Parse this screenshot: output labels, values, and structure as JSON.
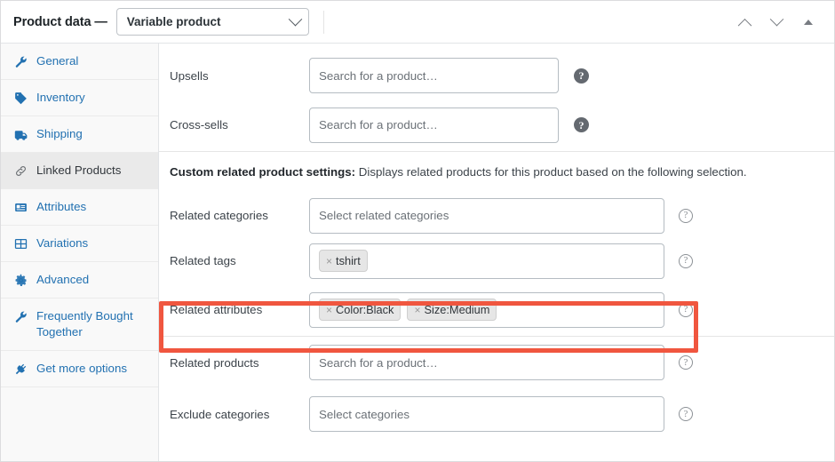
{
  "header": {
    "title": "Product data —",
    "product_type": "Variable product",
    "controls": {
      "move_up": "chevron-up",
      "move_down": "chevron-down",
      "toggle": "triangle-up"
    }
  },
  "sidebar": {
    "items": [
      {
        "label": "General",
        "icon": "wrench-icon",
        "active": false
      },
      {
        "label": "Inventory",
        "icon": "tag-icon",
        "active": false
      },
      {
        "label": "Shipping",
        "icon": "truck-icon",
        "active": false
      },
      {
        "label": "Linked Products",
        "icon": "link-icon",
        "active": true
      },
      {
        "label": "Attributes",
        "icon": "attributes-icon",
        "active": false
      },
      {
        "label": "Variations",
        "icon": "grid-icon",
        "active": false
      },
      {
        "label": "Advanced",
        "icon": "gear-icon",
        "active": false
      },
      {
        "label": "Frequently Bought Together",
        "icon": "wrench-icon",
        "active": false
      },
      {
        "label": "Get more options",
        "icon": "plugin-icon",
        "active": false
      }
    ]
  },
  "main": {
    "top_fields": [
      {
        "label": "Upsells",
        "placeholder": "Search for a product…",
        "help": "?"
      },
      {
        "label": "Cross-sells",
        "placeholder": "Search for a product…",
        "help": "?"
      }
    ],
    "section_note": {
      "bold": "Custom related product settings:",
      "rest": " Displays related products for this product based on the following selection."
    },
    "related_fields": [
      {
        "label": "Related categories",
        "placeholder": "Select related categories",
        "chips": [],
        "help": "?"
      },
      {
        "label": "Related tags",
        "placeholder": "",
        "chips": [
          {
            "remove": "×",
            "text": "tshirt"
          }
        ],
        "help": "?"
      },
      {
        "label": "Related attributes",
        "placeholder": "",
        "chips": [
          {
            "remove": "×",
            "text": "Color:Black"
          },
          {
            "remove": "×",
            "text": "Size:Medium"
          }
        ],
        "help": "?",
        "highlighted": true
      },
      {
        "label": "Related products",
        "placeholder": "Search for a product…",
        "chips": [],
        "help": "?"
      },
      {
        "label": "Exclude categories",
        "placeholder": "Select categories",
        "chips": [],
        "help": "?"
      }
    ]
  },
  "colors": {
    "link_blue": "#2271b1",
    "annotation_red": "#f0563f",
    "active_tab_bg": "#eaeaea",
    "chip_bg": "#e6e6e6"
  }
}
